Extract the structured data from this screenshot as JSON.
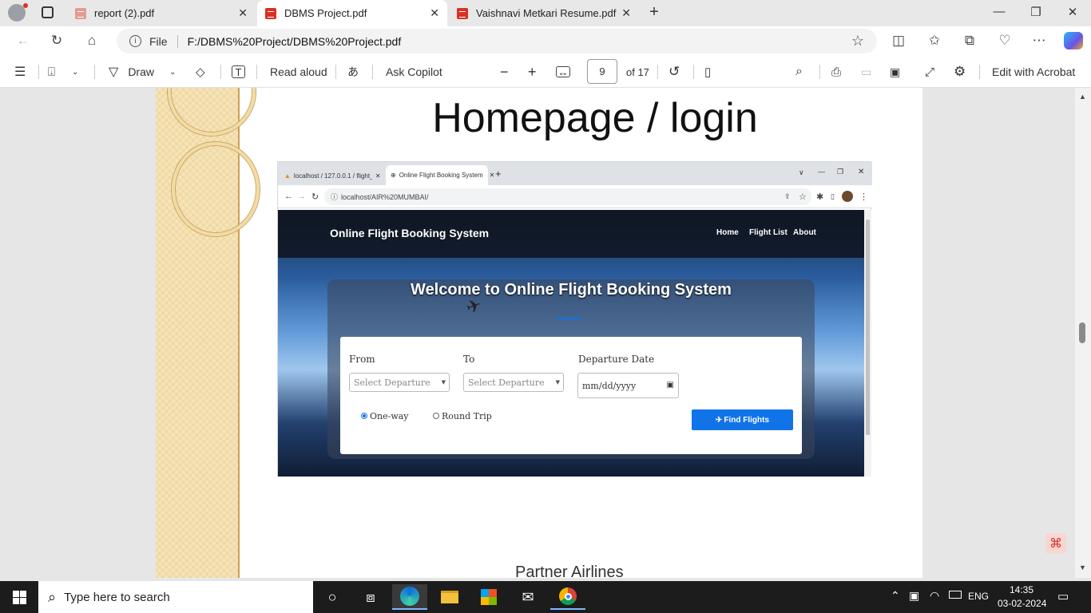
{
  "browser": {
    "tabs": [
      {
        "label": "report (2).pdf",
        "active": false
      },
      {
        "label": "DBMS Project.pdf",
        "active": true
      },
      {
        "label": "Vaishnavi Metkari Resume.pdf",
        "active": false
      }
    ],
    "new_tab_icon": "plus-icon",
    "address": {
      "file_label": "File",
      "url": "F:/DBMS%20Project/DBMS%20Project.pdf"
    }
  },
  "pdf_toolbar": {
    "draw_label": "Draw",
    "read_aloud_label": "Read aloud",
    "ask_copilot_label": "Ask Copilot",
    "page_current": "9",
    "page_total": "of 17",
    "edit_acrobat_label": "Edit with Acrobat"
  },
  "slide": {
    "title": "Homepage / login",
    "footer_heading": "Partner Airlines"
  },
  "inner_browser": {
    "tab1": "localhost / 127.0.0.1 / flight_boo",
    "tab2": "Online Flight Booking System",
    "url": "localhost/AIR%20MUMBAI/",
    "site": {
      "brand": "Online Flight Booking System",
      "nav": [
        "Home",
        "Flight List",
        "About"
      ],
      "welcome": "Welcome to Online Flight Booking System",
      "form": {
        "from_label": "From",
        "to_label": "To",
        "date_label": "Departure Date",
        "from_placeholder": "Select Departure",
        "to_placeholder": "Select Departure",
        "date_placeholder": "mm/dd/yyyy",
        "one_way": "One-way",
        "round_trip": "Round Trip",
        "find_button": "Find Flights"
      }
    }
  },
  "taskbar": {
    "search_placeholder": "Type here to search",
    "language": "ENG",
    "time": "14:35",
    "date": "03-02-2024"
  },
  "colors": {
    "accent_blue": "#1173e8",
    "pdf_red": "#d93025",
    "taskbar": "#1c1c1c"
  }
}
